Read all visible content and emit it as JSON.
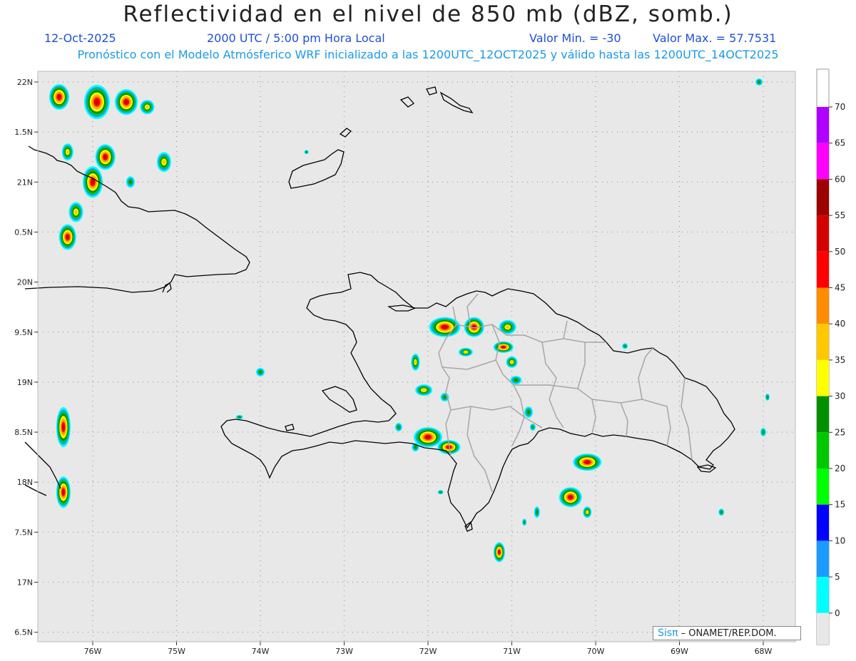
{
  "header": {
    "title": "Reflectividad en el nivel de 850 mb (dBZ, somb.)",
    "date": "12-Oct-2025",
    "time": "2000 UTC / 5:00 pm Hora Local",
    "min": "Valor Min. = -30",
    "max": "Valor Max. = 57.7531",
    "forecast": "Pronóstico con el Modelo Atmósferico WRF inicializado a las 1200UTC_12OCT2025 y válido hasta las  1200UTC_14OCT2025"
  },
  "map": {
    "lon_labels": [
      "76W",
      "75W",
      "74W",
      "73W",
      "72W",
      "71W",
      "70W",
      "69W",
      "68W"
    ],
    "lat_labels": [
      "22N",
      "1.5N",
      "21N",
      "0.5N",
      "20N",
      "9.5N",
      "19N",
      "8.5N",
      "18N",
      "7.5N",
      "17N",
      "6.5N"
    ],
    "land_color": "#e8e8e8",
    "coast_color": "#000000",
    "border_color": "#a6a6a6"
  },
  "colorbar": {
    "labels": [
      "0",
      "5",
      "10",
      "15",
      "20",
      "25",
      "30",
      "35",
      "40",
      "45",
      "50",
      "55",
      "60",
      "65",
      "70"
    ],
    "colors": [
      "#00ffff",
      "#1a9bff",
      "#0000ff",
      "#00ff00",
      "#00c800",
      "#009000",
      "#ffff00",
      "#ffc800",
      "#ff8c00",
      "#ff0000",
      "#d40000",
      "#9c0000",
      "#ff00ff",
      "#b000ff"
    ]
  },
  "credit": {
    "brand": "Sisπ",
    "org": "– ONAMET/REP.DOM."
  },
  "storms": [
    {
      "lon": -76.4,
      "lat": 21.85,
      "rx": 14,
      "ry": 18,
      "int": 3
    },
    {
      "lon": -75.95,
      "lat": 21.8,
      "rx": 18,
      "ry": 24,
      "int": 3
    },
    {
      "lon": -75.6,
      "lat": 21.8,
      "rx": 16,
      "ry": 18,
      "int": 3
    },
    {
      "lon": -75.35,
      "lat": 21.75,
      "rx": 10,
      "ry": 10,
      "int": 2
    },
    {
      "lon": -76.3,
      "lat": 21.3,
      "rx": 8,
      "ry": 12,
      "int": 2
    },
    {
      "lon": -75.85,
      "lat": 21.25,
      "rx": 14,
      "ry": 18,
      "int": 3
    },
    {
      "lon": -76.0,
      "lat": 21.0,
      "rx": 14,
      "ry": 22,
      "int": 3
    },
    {
      "lon": -76.2,
      "lat": 20.7,
      "rx": 10,
      "ry": 14,
      "int": 2
    },
    {
      "lon": -76.3,
      "lat": 20.45,
      "rx": 12,
      "ry": 18,
      "int": 3
    },
    {
      "lon": -75.15,
      "lat": 21.2,
      "rx": 10,
      "ry": 14,
      "int": 2
    },
    {
      "lon": -75.55,
      "lat": 21.0,
      "rx": 6,
      "ry": 8,
      "int": 1
    },
    {
      "lon": -76.35,
      "lat": 18.55,
      "rx": 10,
      "ry": 28,
      "int": 3
    },
    {
      "lon": -76.35,
      "lat": 17.9,
      "rx": 10,
      "ry": 22,
      "int": 3
    },
    {
      "lon": -74.0,
      "lat": 19.1,
      "rx": 6,
      "ry": 6,
      "int": 1
    },
    {
      "lon": -71.8,
      "lat": 19.55,
      "rx": 22,
      "ry": 14,
      "int": 3
    },
    {
      "lon": -71.45,
      "lat": 19.55,
      "rx": 14,
      "ry": 14,
      "int": 3
    },
    {
      "lon": -71.05,
      "lat": 19.55,
      "rx": 12,
      "ry": 10,
      "int": 2
    },
    {
      "lon": -71.1,
      "lat": 19.35,
      "rx": 14,
      "ry": 8,
      "int": 3
    },
    {
      "lon": -71.0,
      "lat": 19.2,
      "rx": 8,
      "ry": 8,
      "int": 2
    },
    {
      "lon": -71.55,
      "lat": 19.3,
      "rx": 10,
      "ry": 6,
      "int": 2
    },
    {
      "lon": -72.15,
      "lat": 19.2,
      "rx": 6,
      "ry": 12,
      "int": 2
    },
    {
      "lon": -72.05,
      "lat": 18.92,
      "rx": 12,
      "ry": 8,
      "int": 2
    },
    {
      "lon": -71.8,
      "lat": 18.85,
      "rx": 6,
      "ry": 6,
      "int": 1
    },
    {
      "lon": -70.95,
      "lat": 19.02,
      "rx": 8,
      "ry": 6,
      "int": 1
    },
    {
      "lon": -72.0,
      "lat": 18.45,
      "rx": 20,
      "ry": 14,
      "int": 3
    },
    {
      "lon": -71.75,
      "lat": 18.35,
      "rx": 16,
      "ry": 10,
      "int": 3
    },
    {
      "lon": -72.35,
      "lat": 18.55,
      "rx": 5,
      "ry": 6,
      "int": 1
    },
    {
      "lon": -72.15,
      "lat": 18.35,
      "rx": 5,
      "ry": 6,
      "int": 1
    },
    {
      "lon": -70.8,
      "lat": 18.7,
      "rx": 6,
      "ry": 8,
      "int": 1
    },
    {
      "lon": -70.1,
      "lat": 18.2,
      "rx": 20,
      "ry": 12,
      "int": 3
    },
    {
      "lon": -70.3,
      "lat": 17.85,
      "rx": 16,
      "ry": 14,
      "int": 3
    },
    {
      "lon": -70.1,
      "lat": 17.7,
      "rx": 6,
      "ry": 8,
      "int": 2
    },
    {
      "lon": -71.15,
      "lat": 17.3,
      "rx": 8,
      "ry": 14,
      "int": 3
    },
    {
      "lon": -70.7,
      "lat": 17.7,
      "rx": 4,
      "ry": 8,
      "int": 1
    },
    {
      "lon": -69.65,
      "lat": 19.36,
      "rx": 4,
      "ry": 4,
      "int": 1
    },
    {
      "lon": -68.5,
      "lat": 17.7,
      "rx": 4,
      "ry": 5,
      "int": 1
    },
    {
      "lon": -68.0,
      "lat": 18.5,
      "rx": 4,
      "ry": 6,
      "int": 1
    },
    {
      "lon": -67.95,
      "lat": 18.85,
      "rx": 3,
      "ry": 5,
      "int": 1
    },
    {
      "lon": -68.05,
      "lat": 22.0,
      "rx": 5,
      "ry": 5,
      "int": 1
    },
    {
      "lon": -74.25,
      "lat": 18.65,
      "rx": 5,
      "ry": 3,
      "int": 1
    },
    {
      "lon": -73.45,
      "lat": 21.3,
      "rx": 3,
      "ry": 3,
      "int": 1
    },
    {
      "lon": -71.85,
      "lat": 17.9,
      "rx": 4,
      "ry": 3,
      "int": 1
    },
    {
      "lon": -70.85,
      "lat": 17.6,
      "rx": 3,
      "ry": 5,
      "int": 1
    },
    {
      "lon": -70.75,
      "lat": 18.55,
      "rx": 4,
      "ry": 5,
      "int": 1
    }
  ]
}
